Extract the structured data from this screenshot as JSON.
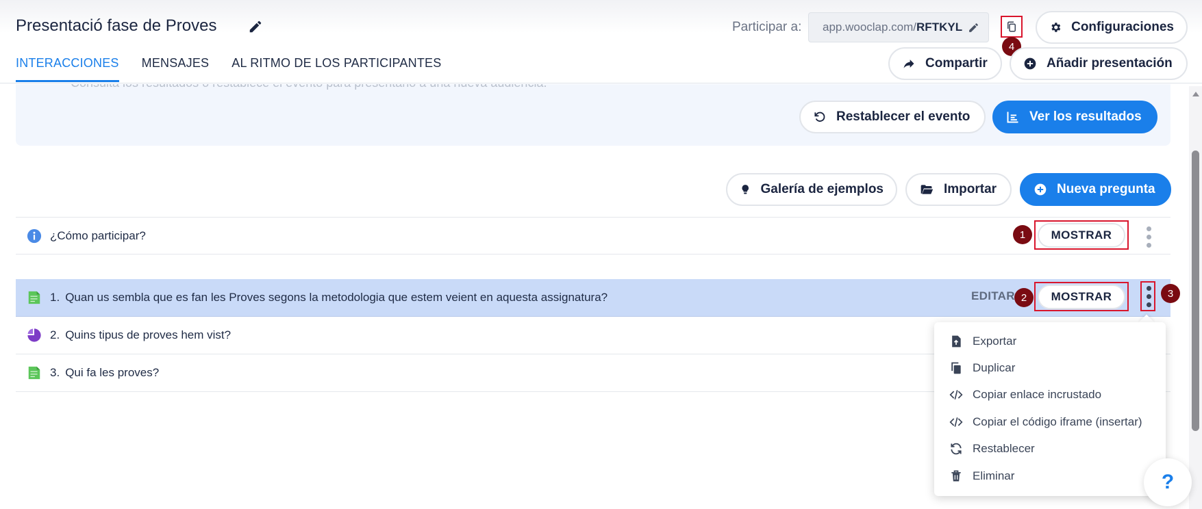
{
  "header": {
    "title": "Presentació fase de Proves",
    "participate_label": "Participar a:",
    "url_prefix": "app.wooclap.com/",
    "url_code": "RFTKYL",
    "configure_label": "Configuraciones",
    "share_label": "Compartir",
    "add_presentation_label": "Añadir presentación"
  },
  "tabs": [
    {
      "label": "INTERACCIONES",
      "active": true
    },
    {
      "label": "MENSAJES",
      "active": false
    },
    {
      "label": "AL RITMO DE LOS PARTICIPANTES",
      "active": false
    }
  ],
  "info_panel": {
    "faded_text": "Consulta los resultados o restablece el evento para presentarlo a una nueva audiencia.",
    "reset_label": "Restablecer el evento",
    "results_label": "Ver los resultados"
  },
  "toolbar": {
    "gallery_label": "Galería de ejemplos",
    "import_label": "Importar",
    "new_question_label": "Nueva pregunta"
  },
  "how_to": {
    "text": "¿Cómo participar?",
    "show_label": "MOSTRAR"
  },
  "questions": [
    {
      "number": "1.",
      "text": "Quan us sembla que es fan les Proves segons la metodologia que estem veient en aquesta assignatura?",
      "icon": "green-document-icon",
      "edit_label": "EDITAR",
      "show_label": "MOSTRAR"
    },
    {
      "number": "2.",
      "text": "Quins tipus de proves hem vist?",
      "icon": "purple-pie-icon"
    },
    {
      "number": "3.",
      "text": "Qui fa les proves?",
      "icon": "green-document-icon"
    }
  ],
  "menu": {
    "items": [
      {
        "label": "Exportar",
        "icon": "export-icon"
      },
      {
        "label": "Duplicar",
        "icon": "duplicate-icon"
      },
      {
        "label": "Copiar enlace incrustado",
        "icon": "code-icon"
      },
      {
        "label": "Copiar el código iframe (insertar)",
        "icon": "code-icon"
      },
      {
        "label": "Restablecer",
        "icon": "refresh-icon"
      },
      {
        "label": "Eliminar",
        "icon": "trash-icon"
      }
    ]
  },
  "annotations": {
    "b1": "1",
    "b2": "2",
    "b3": "3",
    "b4": "4"
  },
  "help_label": "?",
  "colors": {
    "accent": "#1a7fea",
    "highlight": "#c9daf8",
    "annotation": "#d9152c",
    "badge": "#7a0b12"
  }
}
